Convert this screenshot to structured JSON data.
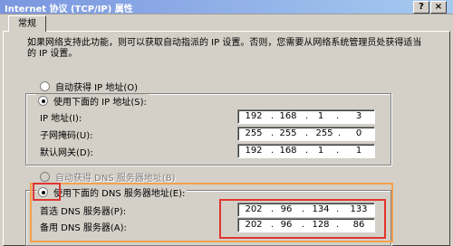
{
  "window": {
    "title": "Internet 协议 (TCP/IP) 属性",
    "help_btn": "?",
    "close_btn": "×"
  },
  "tab": "常规",
  "description": "如果网络支持此功能，则可以获取自动指派的 IP 设置。否则，您需要从网络系统管理员处获得适当的 IP 设置。",
  "ip_auto_radio": "自动获得 IP 地址(O)",
  "ip_manual_radio": "使用下面的 IP 地址(S):",
  "ip_address": {
    "label": "IP 地址(I):",
    "octets": [
      "192",
      "168",
      "1",
      "3"
    ]
  },
  "subnet_mask": {
    "label": "子网掩码(U):",
    "octets": [
      "255",
      "255",
      "255",
      "0"
    ]
  },
  "gateway": {
    "label": "默认网关(D):",
    "octets": [
      "192",
      "168",
      "1",
      "1"
    ]
  },
  "dns_auto_radio": "自动获得 DNS 服务器地址(B)",
  "dns_manual_radio": "使用下面的 DNS 服务器地址(E):",
  "dns_preferred": {
    "label": "首选 DNS 服务器(P):",
    "octets": [
      "202",
      "96",
      "134",
      "133"
    ]
  },
  "dns_alternate": {
    "label": "备用 DNS 服务器(A):",
    "octets": [
      "202",
      "96",
      "128",
      "86"
    ]
  },
  "colors": {
    "highlight_orange": "#f4a04f",
    "highlight_red": "#e0352f",
    "titlebar": "#7a96df"
  }
}
